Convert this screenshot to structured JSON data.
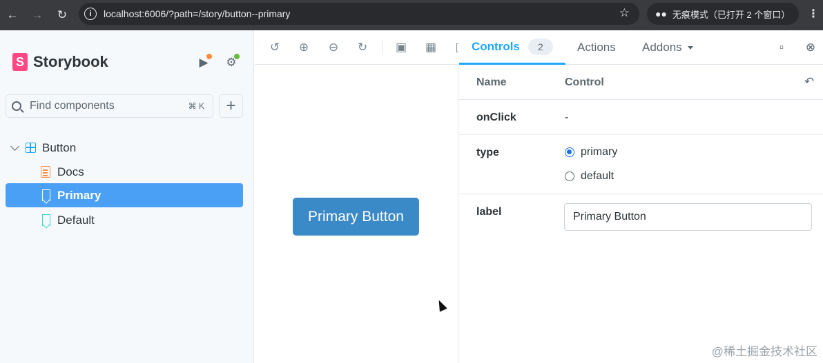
{
  "browser": {
    "url": "localhost:6006/?path=/story/button--primary",
    "incognito_label": "无痕模式（已打开 2 个窗口）"
  },
  "sidebar": {
    "brand": "Storybook",
    "logo_letter": "S",
    "search_placeholder": "Find components",
    "search_shortcut": "⌘ K",
    "tree": [
      {
        "label": "Button",
        "kind": "component",
        "selected": false
      },
      {
        "label": "Docs",
        "kind": "docs",
        "selected": false
      },
      {
        "label": "Primary",
        "kind": "story",
        "selected": true
      },
      {
        "label": "Default",
        "kind": "story",
        "selected": false
      }
    ]
  },
  "preview": {
    "button_label": "Primary Button"
  },
  "panel": {
    "tabs": [
      {
        "label": "Controls",
        "badge": "2",
        "active": true
      },
      {
        "label": "Actions",
        "active": false
      },
      {
        "label": "Addons",
        "active": false
      }
    ],
    "header": {
      "name": "Name",
      "control": "Control"
    },
    "rows": [
      {
        "name": "onClick",
        "value": "-"
      },
      {
        "name": "type",
        "options": [
          "primary",
          "default"
        ],
        "selected": "primary"
      },
      {
        "name": "label",
        "value": "Primary Button"
      }
    ]
  },
  "watermark": "@稀土掘金技术社区",
  "colors": {
    "accent": "#1ea7fd",
    "selected_item": "#4aa0f5",
    "logo": "#ff4785",
    "primary_button": "#3b8ac8"
  }
}
